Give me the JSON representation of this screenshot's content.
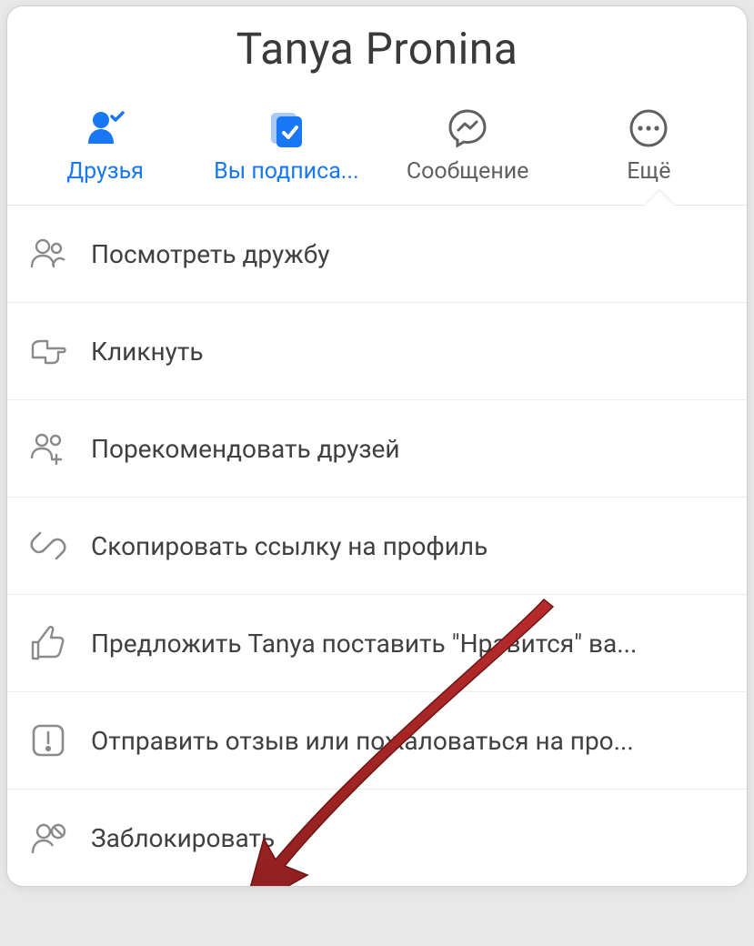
{
  "profile": {
    "name": "Tanya Pronina"
  },
  "actions": {
    "friends": {
      "label": "Друзья",
      "active": true
    },
    "subscribed": {
      "label": "Вы подписа...",
      "active": true
    },
    "message": {
      "label": "Сообщение",
      "active": false
    },
    "more": {
      "label": "Ещё",
      "active": false
    }
  },
  "menu": [
    {
      "id": "view-friendship",
      "label": "Посмотреть дружбу"
    },
    {
      "id": "poke",
      "label": "Кликнуть"
    },
    {
      "id": "suggest-friends",
      "label": "Порекомендовать друзей"
    },
    {
      "id": "copy-link",
      "label": "Скопировать ссылку на профиль"
    },
    {
      "id": "suggest-like",
      "label": "Предложить Tanya поставить \"Нравится\" ва..."
    },
    {
      "id": "report",
      "label": "Отправить отзыв или пожаловаться на про..."
    },
    {
      "id": "block",
      "label": "Заблокировать"
    }
  ]
}
